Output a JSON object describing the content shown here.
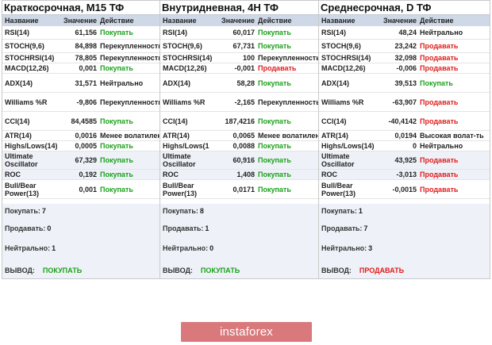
{
  "headers": {
    "name": "Название",
    "value": "Значение",
    "action": "Действие"
  },
  "panels": [
    {
      "title": "Краткосрочная, M15 ТФ",
      "rows": [
        {
          "name": "RSI(14)",
          "value": "61,156",
          "action": "Покупать",
          "status": "buy"
        },
        {
          "name": "STOCH(9,6)",
          "value": "84,898",
          "action": "Перекупленность",
          "status": "neutral"
        },
        {
          "name": "STOCHRSI(14)",
          "value": "78,805",
          "action": "Перекупленность",
          "status": "neutral"
        },
        {
          "name": "MACD(12,26)",
          "value": "0,001",
          "action": "Покупать",
          "status": "buy"
        },
        {
          "name": "ADX(14)",
          "value": "31,571",
          "action": "Нейтрально",
          "status": "neutral"
        },
        {
          "name": "Williams %R",
          "value": "-9,806",
          "action": "Перекупленность",
          "status": "neutral"
        },
        {
          "name": "CCI(14)",
          "value": "84,4585",
          "action": "Покупать",
          "status": "buy"
        },
        {
          "name": "ATR(14)",
          "value": "0,0016",
          "action": "Менее волатилен",
          "status": "neutral"
        },
        {
          "name": "Highs/Lows(14)",
          "value": "0,0005",
          "action": "Покупать",
          "status": "buy"
        },
        {
          "name": "Ultimate Oscillator",
          "value": "67,329",
          "action": "Покупать",
          "status": "buy"
        },
        {
          "name": "ROC",
          "value": "0,192",
          "action": "Покупать",
          "status": "buy"
        },
        {
          "name": "Bull/Bear Power(13)",
          "value": "0,001",
          "action": "Покупать",
          "status": "buy"
        }
      ],
      "summary": {
        "buy_label": "Покупать:",
        "buy_count": "7",
        "sell_label": "Продавать:",
        "sell_count": "0",
        "neutral_label": "Нейтрально:",
        "neutral_count": "1",
        "verdict_label": "ВЫВОД:",
        "verdict": "ПОКУПАТЬ",
        "verdict_status": "buy"
      }
    },
    {
      "title": "Внутридневная, 4H ТФ",
      "rows": [
        {
          "name": "RSI(14)",
          "value": "60,017",
          "action": "Покупать",
          "status": "buy"
        },
        {
          "name": "STOCH(9,6)",
          "value": "67,731",
          "action": "Покупать",
          "status": "buy"
        },
        {
          "name": "STOCHRSI(14)",
          "value": "100",
          "action": "Перекупленность",
          "status": "neutral"
        },
        {
          "name": "MACD(12,26)",
          "value": "-0,001",
          "action": "Продавать",
          "status": "sell"
        },
        {
          "name": "ADX(14)",
          "value": "58,28",
          "action": "Покупать",
          "status": "buy"
        },
        {
          "name": "Williams %R",
          "value": "-2,165",
          "action": "Перекупленность",
          "status": "neutral"
        },
        {
          "name": "CCI(14)",
          "value": "187,4216",
          "action": "Покупать",
          "status": "buy"
        },
        {
          "name": "ATR(14)",
          "value": "0,0065",
          "action": "Менее волатилен",
          "status": "neutral"
        },
        {
          "name": "Highs/Lows(1",
          "value": "0,0088",
          "action": "Покупать",
          "status": "buy"
        },
        {
          "name": "Ultimate Oscillator",
          "value": "60,916",
          "action": "Покупать",
          "status": "buy"
        },
        {
          "name": "ROC",
          "value": "1,408",
          "action": "Покупать",
          "status": "buy"
        },
        {
          "name": "Bull/Bear Power(13)",
          "value": "0,0171",
          "action": "Покупать",
          "status": "buy"
        }
      ],
      "summary": {
        "buy_label": "Покупать:",
        "buy_count": "8",
        "sell_label": "Продавать:",
        "sell_count": "1",
        "neutral_label": "Нейтрально:",
        "neutral_count": "0",
        "verdict_label": "ВЫВОД:",
        "verdict": "ПОКУПАТЬ",
        "verdict_status": "buy"
      }
    },
    {
      "title": "Среднесрочная, D ТФ",
      "rows": [
        {
          "name": "RSI(14)",
          "value": "48,24",
          "action": "Нейтрально",
          "status": "neutral"
        },
        {
          "name": "STOCH(9,6)",
          "value": "23,242",
          "action": "Продавать",
          "status": "sell"
        },
        {
          "name": "STOCHRSI(14)",
          "value": "32,098",
          "action": "Продавать",
          "status": "sell"
        },
        {
          "name": "MACD(12,26)",
          "value": "-0,006",
          "action": "Продавать",
          "status": "sell"
        },
        {
          "name": "ADX(14)",
          "value": "39,513",
          "action": "Покупать",
          "status": "buy"
        },
        {
          "name": "Williams %R",
          "value": "-63,907",
          "action": "Продавать",
          "status": "sell"
        },
        {
          "name": "CCI(14)",
          "value": "-40,4142",
          "action": "Продавать",
          "status": "sell"
        },
        {
          "name": "ATR(14)",
          "value": "0,0194",
          "action": "Высокая волат-ть",
          "status": "neutral"
        },
        {
          "name": "Highs/Lows(14)",
          "value": "0",
          "action": "Нейтрально",
          "status": "neutral"
        },
        {
          "name": "Ultimate Oscillator",
          "value": "43,925",
          "action": "Продавать",
          "status": "sell"
        },
        {
          "name": "ROC",
          "value": "-3,013",
          "action": "Продавать",
          "status": "sell"
        },
        {
          "name": "Bull/Bear Power(13)",
          "value": "-0,0015",
          "action": "Продавать",
          "status": "sell"
        }
      ],
      "summary": {
        "buy_label": "Покупать:",
        "buy_count": "1",
        "sell_label": "Продавать:",
        "sell_count": "7",
        "neutral_label": "Нейтрально:",
        "neutral_count": "3",
        "verdict_label": "ВЫВОД:",
        "verdict": "ПРОДАВАТЬ",
        "verdict_status": "sell"
      }
    }
  ],
  "banner": {
    "text": "instaforex"
  }
}
